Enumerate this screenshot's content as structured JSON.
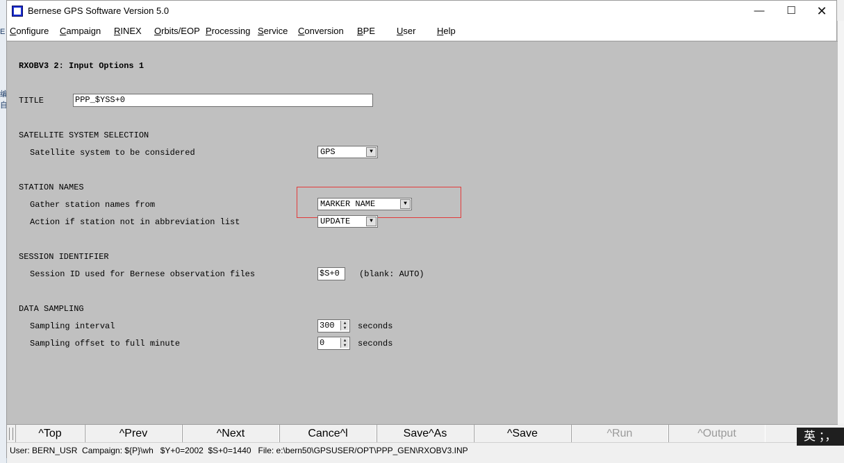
{
  "window": {
    "title": "Bernese GPS Software Version 5.0"
  },
  "controls": {
    "minimize": "—",
    "maximize": "☐",
    "close": "✕"
  },
  "menu": [
    "Configure",
    "Campaign",
    "RINEX",
    "Orbits/EOP",
    "Processing",
    "Service",
    "Conversion",
    "BPE",
    "User",
    "Help"
  ],
  "panel": {
    "heading": "RXOBV3 2: Input Options 1",
    "title_label": "TITLE",
    "title_value": "PPP_$YSS+0",
    "sat_section": "SATELLITE SYSTEM SELECTION",
    "sat_label": "Satellite system to be considered",
    "sat_value": "GPS",
    "station_section": "STATION NAMES",
    "gather_label": "Gather station names from",
    "gather_value": "MARKER NAME",
    "action_label": "Action if station not in abbreviation list",
    "action_value": "UPDATE",
    "session_section": "SESSION IDENTIFIER",
    "session_label": "Session ID used for Bernese observation files",
    "session_value": "$S+0",
    "session_hint": "(blank: AUTO)",
    "sampling_section": "DATA SAMPLING",
    "interval_label": "Sampling interval",
    "interval_value": "300",
    "interval_unit": "seconds",
    "offset_label": "Sampling offset to full minute",
    "offset_value": "0",
    "offset_unit": "seconds"
  },
  "buttons": [
    "^Top",
    "^Prev",
    "^Next",
    "Cance^l",
    "Save^As",
    "^Save",
    "^Run",
    "^Output"
  ],
  "status": "User: BERN_USR  Campaign: ${P}\\wh   $Y+0=2002  $S+0=1440   File: e:\\bern50\\GPSUSER/OPT\\PPP_GEN\\RXOBV3.INP",
  "ime": "英 ；，"
}
